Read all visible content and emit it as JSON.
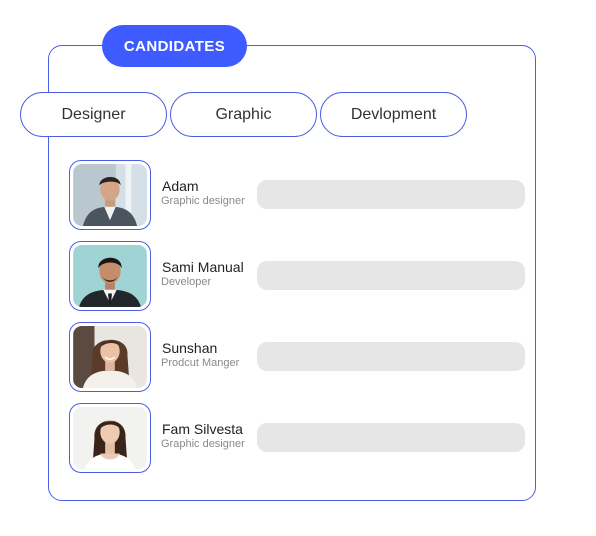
{
  "header": {
    "title": "CANDIDATES"
  },
  "tabs": [
    {
      "label": "Designer"
    },
    {
      "label": "Graphic"
    },
    {
      "label": "Devlopment"
    }
  ],
  "candidates": [
    {
      "name": "Adam",
      "role": "Graphic designer"
    },
    {
      "name": "Sami Manual",
      "role": "Developer"
    },
    {
      "name": "Sunshan",
      "role": "Prodcut Manger"
    },
    {
      "name": "Fam Silvesta",
      "role": "Graphic designer"
    }
  ],
  "colors": {
    "accent": "#3d5bff",
    "border": "#4a5ee6",
    "bar": "#e6e6e6"
  }
}
